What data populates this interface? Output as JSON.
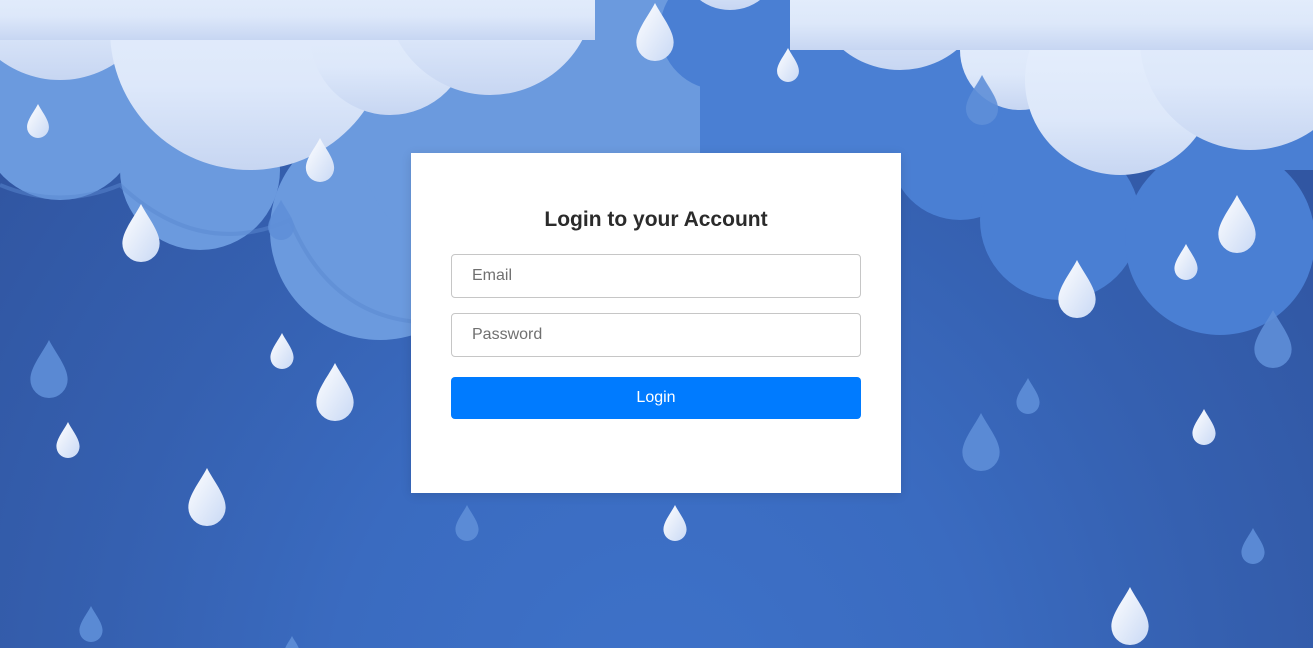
{
  "login": {
    "title": "Login to your Account",
    "email_placeholder": "Email",
    "email_value": "",
    "password_placeholder": "Password",
    "password_value": "",
    "submit_label": "Login"
  },
  "theme": {
    "background": "#3560b0",
    "cloud_light": "#e4eefc",
    "cloud_mid": "#6d9ce0",
    "button": "#007bff",
    "card": "#ffffff",
    "title_color": "#2b2b2b"
  },
  "icons": {
    "decoration": "raindrop-icon"
  }
}
